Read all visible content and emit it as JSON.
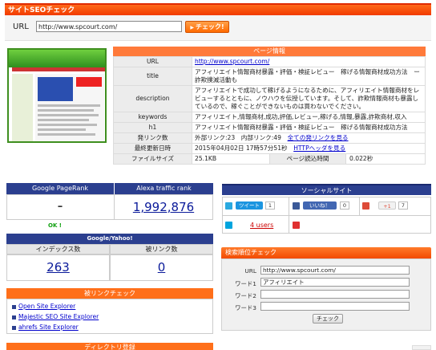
{
  "header": {
    "title": "サイトSEOチェック"
  },
  "url_form": {
    "label": "URL",
    "value": "http://www.spcourt.com/",
    "button": "チェック!"
  },
  "page_info": {
    "heading": "ページ情報",
    "rows": [
      {
        "key": "URL",
        "value": "http://www.spcourt.com/"
      },
      {
        "key": "title",
        "value": "アフィリエイト情報商材暴露・評価・検証レビュー　稼げる情報商材成功方法　ー詐欺撲滅活動も"
      },
      {
        "key": "description",
        "value": "アフィリエイトで成功して稼げるようになるために、アフィリエイト情報商材をレビューするとともに、ノウハウを伝授しています。そして、詐欺情報商材も暴露しているので、稼ぐことができないものは買わないでください。"
      },
      {
        "key": "keywords",
        "value": "アフィリエイト,情報商材,成功,評価,レビュー,稼げる,情報,暴露,詐欺商材,収入"
      },
      {
        "key": "h1",
        "value": "アフィリエイト情報商材暴露・評価・検証レビュー　稼げる情報商材成功方法"
      },
      {
        "key": "発リンク数",
        "value": "外部リンク:23　内部リンク:49",
        "link": "全ての発リンクを見る"
      },
      {
        "key": "最終更新日時",
        "value": "2015年04月02日 17時57分51秒",
        "link": "HTTPヘッダを見る"
      }
    ],
    "filesize_label": "ファイルサイズ",
    "filesize_value": "25.1KB",
    "load_label": "ページ読込時間",
    "load_value": "0.022秒"
  },
  "pagerank": {
    "label": "Google PageRank",
    "value": "–",
    "status": "OK !"
  },
  "alexa": {
    "label": "Alexa traffic rank",
    "value": "1,992,876"
  },
  "google_yahoo": {
    "heading": "Google/Yahoo!",
    "index_label": "インデックス数",
    "index_value": "263",
    "backlink_label": "被リンク数",
    "backlink_value": "0"
  },
  "backlink_check": {
    "heading": "被リンクチェック",
    "items": [
      "Open Site Explorer",
      "Majestic SEO Site Explorer",
      "ahrefs Site Explorer"
    ]
  },
  "directory": {
    "heading": "ディレクトリ登録"
  },
  "social": {
    "heading": "ソーシャルサイト",
    "tweet_label": "ツイート",
    "tweet_count": "1",
    "like_label": "いいね！",
    "like_count": "0",
    "gplus_label": "+1",
    "gplus_count": "7",
    "hatena_users": "4 users"
  },
  "rank_check": {
    "heading": "検索順位チェック",
    "url_label": "URL",
    "url_value": "http://www.spcourt.com/",
    "w1_label": "ワード1",
    "w1_value": "アフィリエイト",
    "w2_label": "ワード2",
    "w2_value": "",
    "w3_label": "ワード3",
    "w3_value": "",
    "button": "チェック"
  },
  "colors": {
    "header_orange": "#f13a00",
    "navy": "#2b3f8f",
    "link_blue": "#0000cc",
    "ok_green": "#11a011"
  }
}
